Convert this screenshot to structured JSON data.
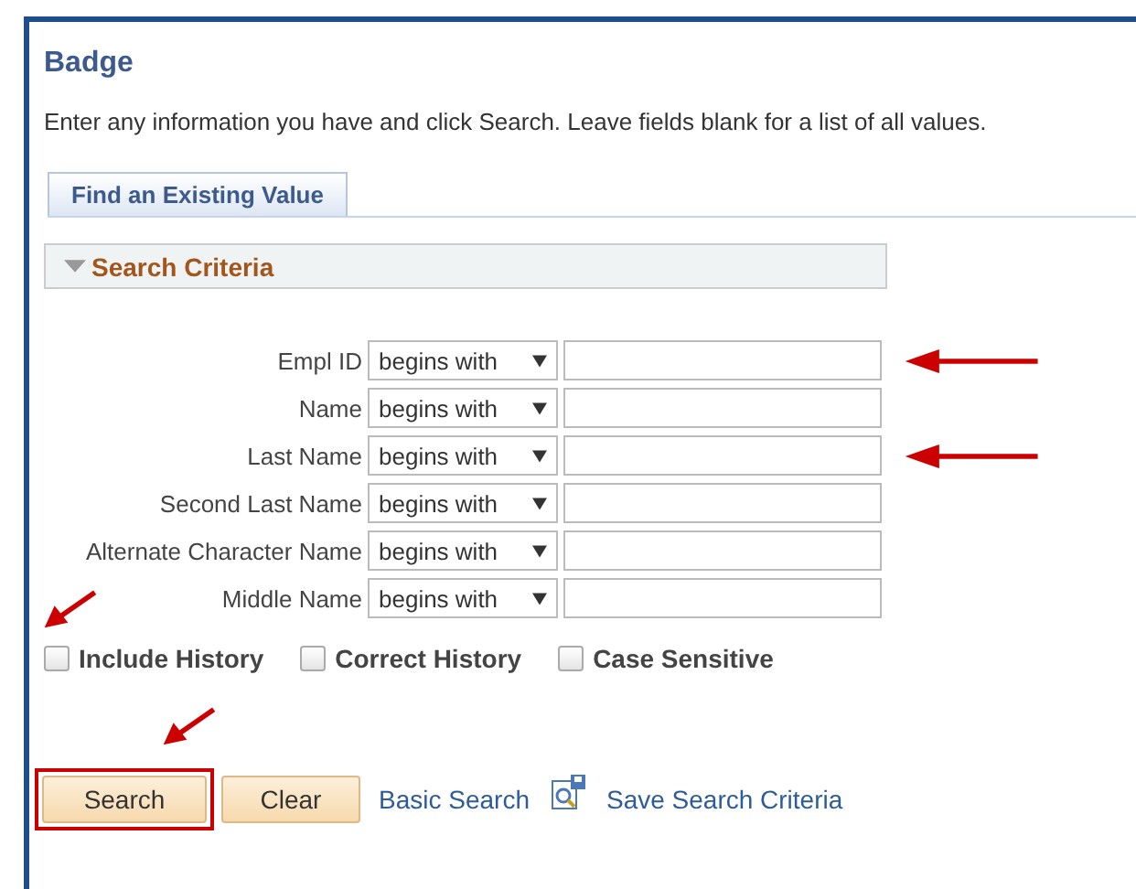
{
  "title": "Badge",
  "instructions": "Enter any information you have and click Search. Leave fields blank for a list of all values.",
  "tabs": [
    {
      "label": "Find an Existing Value",
      "selected": true
    }
  ],
  "section": {
    "title": "Search Criteria",
    "expanded": true
  },
  "fields": [
    {
      "label": "Empl ID",
      "operator": "begins with",
      "marked": true
    },
    {
      "label": "Name",
      "operator": "begins with",
      "marked": false
    },
    {
      "label": "Last Name",
      "operator": "begins with",
      "marked": true
    },
    {
      "label": "Second Last Name",
      "operator": "begins with",
      "marked": false
    },
    {
      "label": "Alternate Character Name",
      "operator": "begins with",
      "marked": false
    },
    {
      "label": "Middle Name",
      "operator": "begins with",
      "marked": false
    }
  ],
  "checkboxes": [
    {
      "label": "Include History",
      "checked": false,
      "marked": true
    },
    {
      "label": "Correct History",
      "checked": false,
      "marked": false
    },
    {
      "label": "Case Sensitive",
      "checked": false,
      "marked": false
    }
  ],
  "buttons": [
    {
      "label": "Search",
      "highlighted": true,
      "marked": true
    },
    {
      "label": "Clear",
      "highlighted": false,
      "marked": false
    }
  ],
  "links": [
    {
      "label": "Basic Search",
      "icon": false
    },
    {
      "label": "Save Search Criteria",
      "icon": true
    }
  ]
}
